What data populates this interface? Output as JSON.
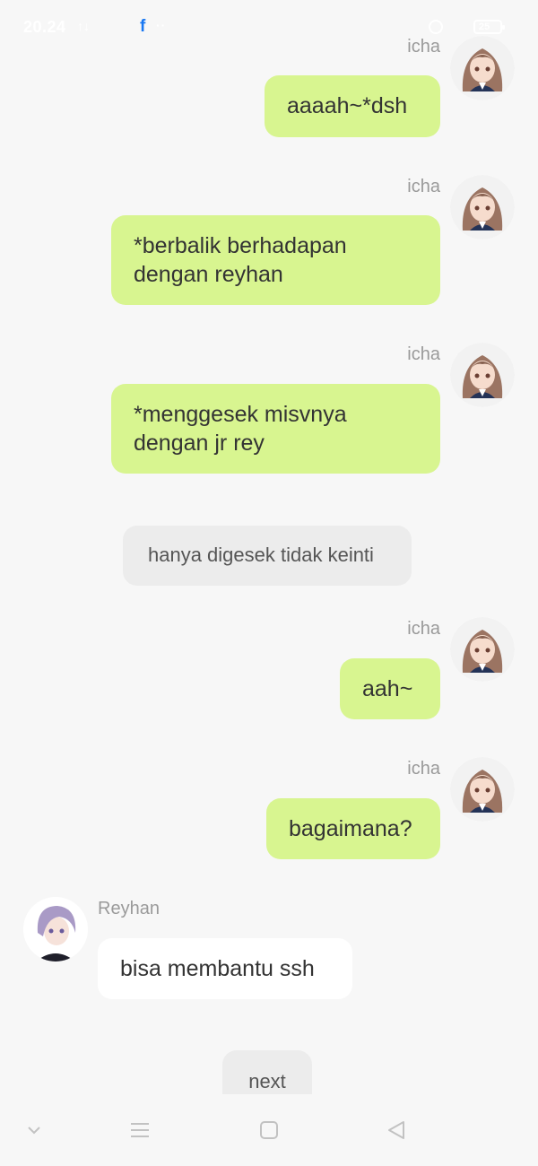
{
  "status_bar": {
    "time": "20.24",
    "signal_text": "↑↓ ",
    "fb_glyph": "f",
    "extra": "··",
    "battery": "25"
  },
  "colors": {
    "user_bubble": "#d8f590",
    "bot_bubble": "#ffffff",
    "narration_bubble": "#ececec",
    "background": "#f7f7f7"
  },
  "messages": [
    {
      "sender": "icha",
      "text": "aaaah~*dsh"
    },
    {
      "sender": "icha",
      "text": "*berbalik berhadapan dengan reyhan"
    },
    {
      "sender": "icha",
      "text": "*menggesek misvnya dengan jr rey"
    },
    {
      "narration": "hanya digesek tidak keinti"
    },
    {
      "sender": "icha",
      "text": "aah~"
    },
    {
      "sender": "icha",
      "text": "bagaimana?"
    },
    {
      "sender": "Reyhan",
      "text": "bisa membantu ssh"
    }
  ],
  "next_label": "next",
  "nav": {
    "items": [
      "chevron-down-icon",
      "menu-icon",
      "home-icon",
      "back-icon"
    ]
  }
}
